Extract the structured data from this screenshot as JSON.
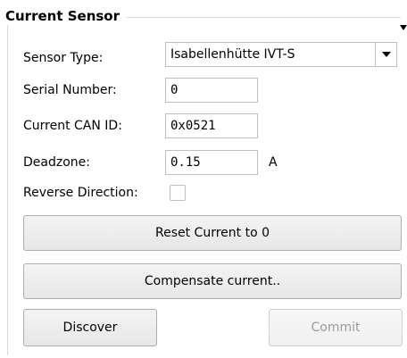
{
  "group": {
    "title": "Current Sensor"
  },
  "sensor_type": {
    "label": "Sensor Type:",
    "value": "Isabellenhütte IVT-S"
  },
  "serial_number": {
    "label": "Serial Number:",
    "value": "0"
  },
  "can_id": {
    "label": "Current CAN ID:",
    "value": "0x0521"
  },
  "deadzone": {
    "label": "Deadzone:",
    "value": "0.15",
    "unit": "A"
  },
  "reverse_direction": {
    "label": "Reverse Direction:",
    "checked": false
  },
  "buttons": {
    "reset_current": "Reset Current to 0",
    "compensate_current": "Compensate current..",
    "discover": "Discover",
    "commit": "Commit"
  }
}
